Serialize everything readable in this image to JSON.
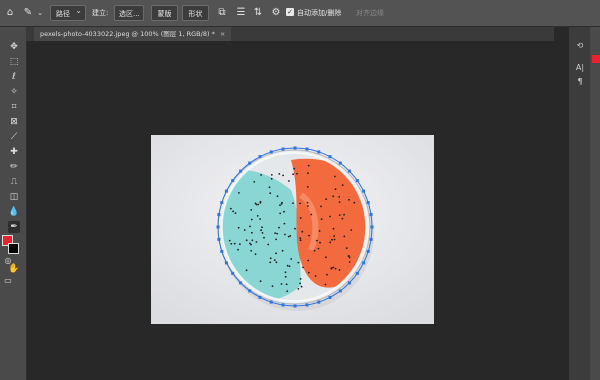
{
  "options_bar": {
    "mode_label": "路径",
    "make_label": "建立:",
    "selection_button": "选区...",
    "mask_button": "蒙版",
    "shape_button": "形状",
    "auto_add_delete_label": "自动添加/删除",
    "align_edges_label": "对齐边缘"
  },
  "document": {
    "tab_title": "pexels-photo-4033022.jpeg @ 100% (图层 1, RGB/8) *",
    "close_glyph": "×"
  },
  "panels": {
    "paragraph_glyph": "¶",
    "character_glyph": "A|"
  },
  "colors": {
    "foreground": "#e8232f",
    "background": "#000000",
    "path_anchor": "#2f74e0"
  },
  "image": {
    "subject": "petri dish with cyan and orange culture",
    "left_culture_color": "#8ad6d4",
    "right_culture_color": "#f26a3e"
  }
}
